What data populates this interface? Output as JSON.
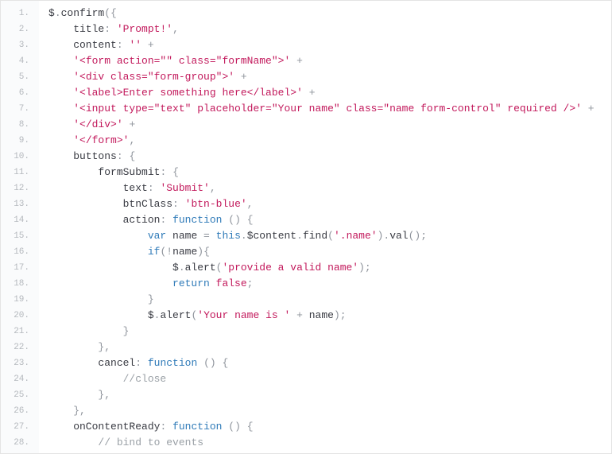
{
  "code": {
    "lines": [
      {
        "n": 1,
        "tokens": [
          [
            "plain",
            "$"
          ],
          [
            "punc",
            "."
          ],
          [
            "plain",
            "confirm"
          ],
          [
            "punc",
            "("
          ],
          [
            "punc",
            "{"
          ]
        ]
      },
      {
        "n": 2,
        "tokens": [
          [
            "plain",
            "    title"
          ],
          [
            "punc",
            ":"
          ],
          [
            "plain",
            " "
          ],
          [
            "str",
            "'Prompt!'"
          ],
          [
            "punc",
            ","
          ]
        ]
      },
      {
        "n": 3,
        "tokens": [
          [
            "plain",
            "    content"
          ],
          [
            "punc",
            ":"
          ],
          [
            "plain",
            " "
          ],
          [
            "str",
            "''"
          ],
          [
            "plain",
            " "
          ],
          [
            "punc",
            "+"
          ]
        ]
      },
      {
        "n": 4,
        "tokens": [
          [
            "plain",
            "    "
          ],
          [
            "str",
            "'<form action=\"\" class=\"formName\">'"
          ],
          [
            "plain",
            " "
          ],
          [
            "punc",
            "+"
          ]
        ]
      },
      {
        "n": 5,
        "tokens": [
          [
            "plain",
            "    "
          ],
          [
            "str",
            "'<div class=\"form-group\">'"
          ],
          [
            "plain",
            " "
          ],
          [
            "punc",
            "+"
          ]
        ]
      },
      {
        "n": 6,
        "tokens": [
          [
            "plain",
            "    "
          ],
          [
            "str",
            "'<label>Enter something here</label>'"
          ],
          [
            "plain",
            " "
          ],
          [
            "punc",
            "+"
          ]
        ]
      },
      {
        "n": 7,
        "tokens": [
          [
            "plain",
            "    "
          ],
          [
            "str",
            "'<input type=\"text\" placeholder=\"Your name\" class=\"name form-control\" required />'"
          ],
          [
            "plain",
            " "
          ],
          [
            "punc",
            "+"
          ]
        ]
      },
      {
        "n": 8,
        "tokens": [
          [
            "plain",
            "    "
          ],
          [
            "str",
            "'</div>'"
          ],
          [
            "plain",
            " "
          ],
          [
            "punc",
            "+"
          ]
        ]
      },
      {
        "n": 9,
        "tokens": [
          [
            "plain",
            "    "
          ],
          [
            "str",
            "'</form>'"
          ],
          [
            "punc",
            ","
          ]
        ]
      },
      {
        "n": 10,
        "tokens": [
          [
            "plain",
            "    buttons"
          ],
          [
            "punc",
            ":"
          ],
          [
            "plain",
            " "
          ],
          [
            "punc",
            "{"
          ]
        ]
      },
      {
        "n": 11,
        "tokens": [
          [
            "plain",
            "        formSubmit"
          ],
          [
            "punc",
            ":"
          ],
          [
            "plain",
            " "
          ],
          [
            "punc",
            "{"
          ]
        ]
      },
      {
        "n": 12,
        "tokens": [
          [
            "plain",
            "            text"
          ],
          [
            "punc",
            ":"
          ],
          [
            "plain",
            " "
          ],
          [
            "str",
            "'Submit'"
          ],
          [
            "punc",
            ","
          ]
        ]
      },
      {
        "n": 13,
        "tokens": [
          [
            "plain",
            "            btnClass"
          ],
          [
            "punc",
            ":"
          ],
          [
            "plain",
            " "
          ],
          [
            "str",
            "'btn-blue'"
          ],
          [
            "punc",
            ","
          ]
        ]
      },
      {
        "n": 14,
        "tokens": [
          [
            "plain",
            "            action"
          ],
          [
            "punc",
            ":"
          ],
          [
            "plain",
            " "
          ],
          [
            "kw",
            "function"
          ],
          [
            "plain",
            " "
          ],
          [
            "punc",
            "("
          ],
          [
            "punc",
            ")"
          ],
          [
            "plain",
            " "
          ],
          [
            "punc",
            "{"
          ]
        ]
      },
      {
        "n": 15,
        "tokens": [
          [
            "plain",
            "                "
          ],
          [
            "kw",
            "var"
          ],
          [
            "plain",
            " name "
          ],
          [
            "punc",
            "="
          ],
          [
            "plain",
            " "
          ],
          [
            "kw",
            "this"
          ],
          [
            "punc",
            "."
          ],
          [
            "plain",
            "$content"
          ],
          [
            "punc",
            "."
          ],
          [
            "plain",
            "find"
          ],
          [
            "punc",
            "("
          ],
          [
            "str",
            "'.name'"
          ],
          [
            "punc",
            ")"
          ],
          [
            "punc",
            "."
          ],
          [
            "plain",
            "val"
          ],
          [
            "punc",
            "("
          ],
          [
            "punc",
            ")"
          ],
          [
            "punc",
            ";"
          ]
        ]
      },
      {
        "n": 16,
        "tokens": [
          [
            "plain",
            "                "
          ],
          [
            "kw",
            "if"
          ],
          [
            "punc",
            "("
          ],
          [
            "punc",
            "!"
          ],
          [
            "plain",
            "name"
          ],
          [
            "punc",
            ")"
          ],
          [
            "punc",
            "{"
          ]
        ]
      },
      {
        "n": 17,
        "tokens": [
          [
            "plain",
            "                    $"
          ],
          [
            "punc",
            "."
          ],
          [
            "plain",
            "alert"
          ],
          [
            "punc",
            "("
          ],
          [
            "str",
            "'provide a valid name'"
          ],
          [
            "punc",
            ")"
          ],
          [
            "punc",
            ";"
          ]
        ]
      },
      {
        "n": 18,
        "tokens": [
          [
            "plain",
            "                    "
          ],
          [
            "kw",
            "return"
          ],
          [
            "plain",
            " "
          ],
          [
            "bool",
            "false"
          ],
          [
            "punc",
            ";"
          ]
        ]
      },
      {
        "n": 19,
        "tokens": [
          [
            "plain",
            "                "
          ],
          [
            "punc",
            "}"
          ]
        ]
      },
      {
        "n": 20,
        "tokens": [
          [
            "plain",
            "                $"
          ],
          [
            "punc",
            "."
          ],
          [
            "plain",
            "alert"
          ],
          [
            "punc",
            "("
          ],
          [
            "str",
            "'Your name is '"
          ],
          [
            "plain",
            " "
          ],
          [
            "punc",
            "+"
          ],
          [
            "plain",
            " name"
          ],
          [
            "punc",
            ")"
          ],
          [
            "punc",
            ";"
          ]
        ]
      },
      {
        "n": 21,
        "tokens": [
          [
            "plain",
            "            "
          ],
          [
            "punc",
            "}"
          ]
        ]
      },
      {
        "n": 22,
        "tokens": [
          [
            "plain",
            "        "
          ],
          [
            "punc",
            "}"
          ],
          [
            "punc",
            ","
          ]
        ]
      },
      {
        "n": 23,
        "tokens": [
          [
            "plain",
            "        cancel"
          ],
          [
            "punc",
            ":"
          ],
          [
            "plain",
            " "
          ],
          [
            "kw",
            "function"
          ],
          [
            "plain",
            " "
          ],
          [
            "punc",
            "("
          ],
          [
            "punc",
            ")"
          ],
          [
            "plain",
            " "
          ],
          [
            "punc",
            "{"
          ]
        ]
      },
      {
        "n": 24,
        "tokens": [
          [
            "plain",
            "            "
          ],
          [
            "comment",
            "//close"
          ]
        ]
      },
      {
        "n": 25,
        "tokens": [
          [
            "plain",
            "        "
          ],
          [
            "punc",
            "}"
          ],
          [
            "punc",
            ","
          ]
        ]
      },
      {
        "n": 26,
        "tokens": [
          [
            "plain",
            "    "
          ],
          [
            "punc",
            "}"
          ],
          [
            "punc",
            ","
          ]
        ]
      },
      {
        "n": 27,
        "tokens": [
          [
            "plain",
            "    onContentReady"
          ],
          [
            "punc",
            ":"
          ],
          [
            "plain",
            " "
          ],
          [
            "kw",
            "function"
          ],
          [
            "plain",
            " "
          ],
          [
            "punc",
            "("
          ],
          [
            "punc",
            ")"
          ],
          [
            "plain",
            " "
          ],
          [
            "punc",
            "{"
          ]
        ]
      },
      {
        "n": 28,
        "tokens": [
          [
            "plain",
            "        "
          ],
          [
            "comment",
            "// bind to events"
          ]
        ]
      }
    ]
  }
}
